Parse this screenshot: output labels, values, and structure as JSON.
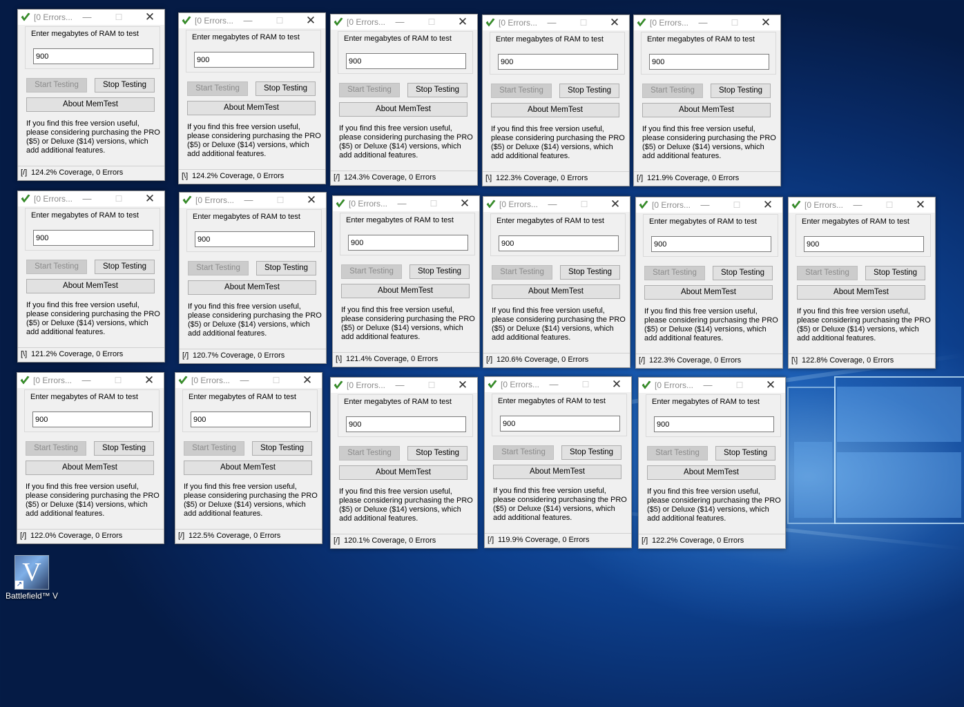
{
  "desktop": {
    "shortcut": {
      "label": "Battlefield™ V",
      "icon": "battlefield-v-icon",
      "glyph": "V"
    }
  },
  "memtest": {
    "title": "[0 Errors...",
    "group_label": "Enter megabytes of RAM to test",
    "ram_value": "900",
    "start_label": "Start Testing",
    "stop_label": "Stop Testing",
    "about_label": "About MemTest",
    "info_text": "If you find this free version useful, please considering purchasing the PRO ($5) or Deluxe ($14) versions, which add additional features.",
    "minimize_glyph": "—",
    "maximize_glyph": "☐",
    "close_glyph": "✕",
    "icon": "memtest-check-icon",
    "accent": "#3a9a2a"
  },
  "windows": [
    {
      "spinner": "[/]",
      "status": "124.2% Coverage, 0 Errors"
    },
    {
      "spinner": "[\\]",
      "status": "124.2% Coverage, 0 Errors"
    },
    {
      "spinner": "[/]",
      "status": "124.3% Coverage, 0 Errors"
    },
    {
      "spinner": "[\\]",
      "status": "122.3% Coverage, 0 Errors"
    },
    {
      "spinner": "[/]",
      "status": "121.9% Coverage, 0 Errors"
    },
    {
      "spinner": "[\\]",
      "status": "121.2% Coverage, 0 Errors"
    },
    {
      "spinner": "[/]",
      "status": "120.7% Coverage, 0 Errors"
    },
    {
      "spinner": "[\\]",
      "status": "121.4% Coverage, 0 Errors"
    },
    {
      "spinner": "[/]",
      "status": "120.6% Coverage, 0 Errors"
    },
    {
      "spinner": "[/]",
      "status": "122.3% Coverage, 0 Errors"
    },
    {
      "spinner": "[\\]",
      "status": "122.8% Coverage, 0 Errors"
    },
    {
      "spinner": "[/]",
      "status": "122.0% Coverage, 0 Errors"
    },
    {
      "spinner": "[/]",
      "status": "122.5% Coverage, 0 Errors"
    },
    {
      "spinner": "[/]",
      "status": "120.1% Coverage, 0 Errors"
    },
    {
      "spinner": "[/]",
      "status": "119.9% Coverage, 0 Errors"
    },
    {
      "spinner": "[/]",
      "status": "122.2% Coverage, 0 Errors"
    }
  ]
}
